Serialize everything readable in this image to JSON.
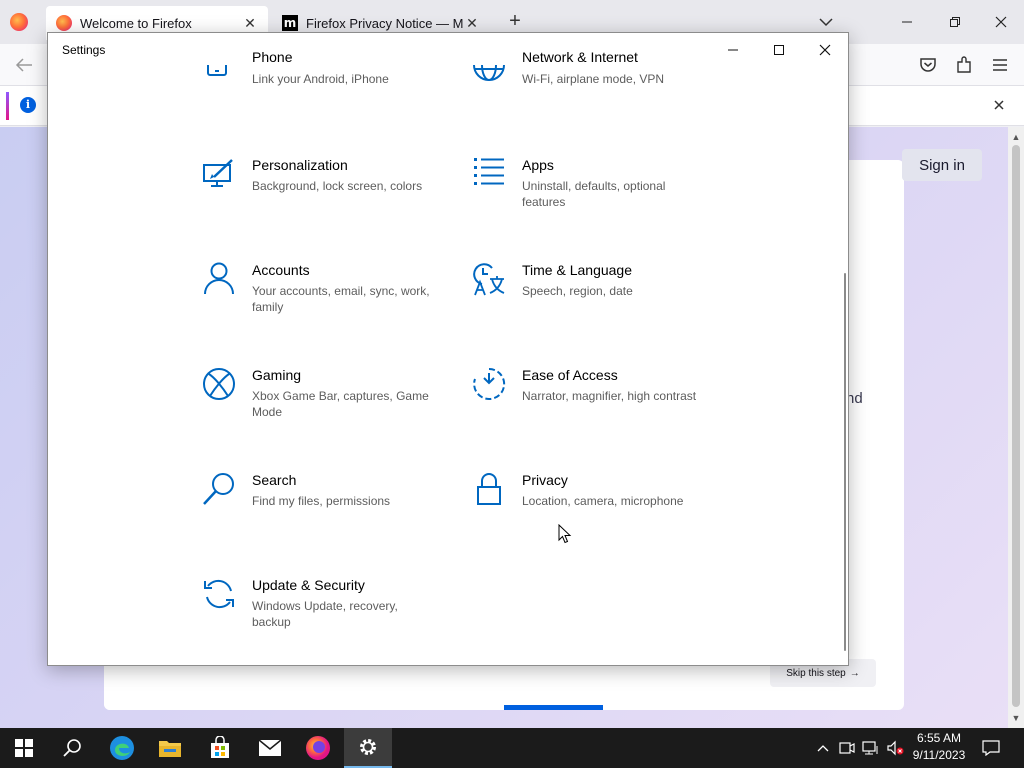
{
  "firefox": {
    "tabs": [
      {
        "title": "Welcome to Firefox",
        "active": true
      },
      {
        "title": "Firefox Privacy Notice — Mozilla",
        "active": false
      }
    ],
    "notification_partial": "I",
    "onboarding": {
      "sign_in_label": "Sign in",
      "partial_text": "nd",
      "skip_label": "Skip this step",
      "skip_arrow": "→",
      "progress": 0.5
    }
  },
  "settings": {
    "window_title": "Settings",
    "tiles": [
      {
        "name": "Phone",
        "description": "Link your Android, iPhone",
        "icon": "phone-icon"
      },
      {
        "name": "Network & Internet",
        "description": "Wi-Fi, airplane mode, VPN",
        "icon": "globe-icon"
      },
      {
        "name": "Personalization",
        "description": "Background, lock screen, colors",
        "icon": "personalization-icon"
      },
      {
        "name": "Apps",
        "description": "Uninstall, defaults, optional features",
        "icon": "apps-icon"
      },
      {
        "name": "Accounts",
        "description": "Your accounts, email, sync, work, family",
        "icon": "person-icon"
      },
      {
        "name": "Time & Language",
        "description": "Speech, region, date",
        "icon": "time-language-icon"
      },
      {
        "name": "Gaming",
        "description": "Xbox Game Bar, captures, Game Mode",
        "icon": "xbox-icon"
      },
      {
        "name": "Ease of Access",
        "description": "Narrator, magnifier, high contrast",
        "icon": "ease-of-access-icon"
      },
      {
        "name": "Search",
        "description": "Find my files, permissions",
        "icon": "search-icon"
      },
      {
        "name": "Privacy",
        "description": "Location, camera, microphone",
        "icon": "lock-icon"
      },
      {
        "name": "Update & Security",
        "description": "Windows Update, recovery, backup",
        "icon": "update-icon"
      }
    ]
  },
  "taskbar": {
    "time": "6:55 AM",
    "date": "9/11/2023",
    "apps": [
      "start-icon",
      "search-icon",
      "edge-icon",
      "file-explorer-icon",
      "store-icon",
      "mail-icon",
      "firefox-icon",
      "settings-gear-icon"
    ]
  },
  "colors": {
    "accent": "#0067c0",
    "firefox_blue": "#0060df",
    "taskbar": "#1b1b1b"
  }
}
